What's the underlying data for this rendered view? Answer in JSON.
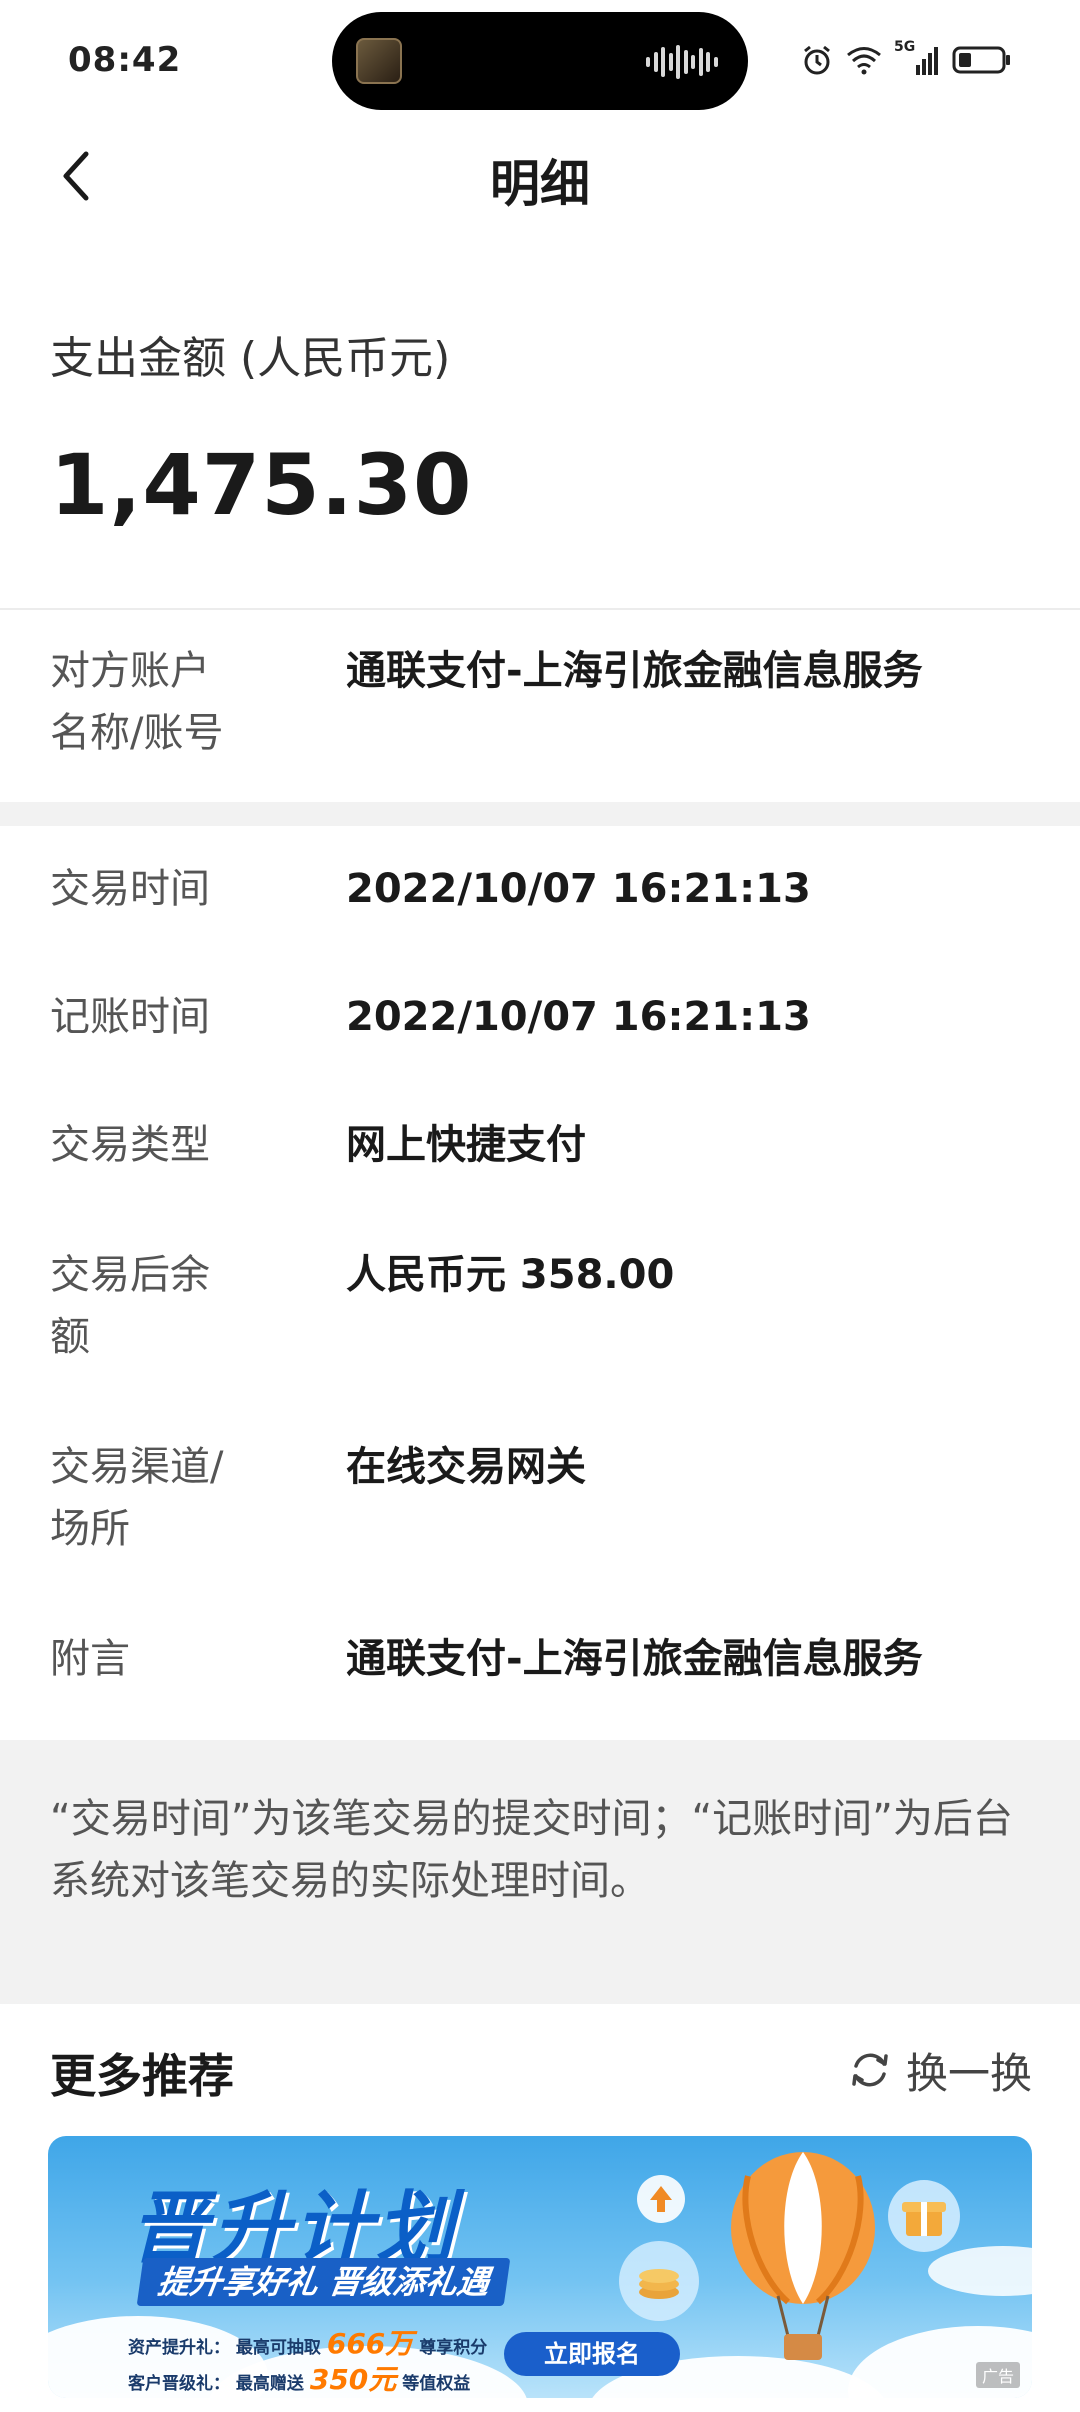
{
  "status": {
    "time": "08:42",
    "network": "5G"
  },
  "nav": {
    "title": "明细"
  },
  "amount": {
    "label": "支出金额 (人民币元)",
    "value": "1,475.30"
  },
  "counterparty": {
    "label_line1": "对方账户",
    "label_line2": "名称/账号",
    "value": "通联支付-上海引旅金融信息服务"
  },
  "details": [
    {
      "label_line1": "交易时间",
      "label_line2": "",
      "value": "2022/10/07 16:21:13"
    },
    {
      "label_line1": "记账时间",
      "label_line2": "",
      "value": "2022/10/07 16:21:13"
    },
    {
      "label_line1": "交易类型",
      "label_line2": "",
      "value": "网上快捷支付"
    },
    {
      "label_line1": "交易后余",
      "label_line2": "额",
      "value": "人民币元 358.00"
    },
    {
      "label_line1": "交易渠道/",
      "label_line2": "场所",
      "value": "在线交易网关"
    },
    {
      "label_line1": "附言",
      "label_line2": "",
      "value": "通联支付-上海引旅金融信息服务"
    }
  ],
  "note": "“交易时间”为该笔交易的提交时间；“记账时间”为后台系统对该笔交易的实际处理时间。",
  "more": {
    "title": "更多推荐",
    "refresh_label": "换一换"
  },
  "banner": {
    "title": "晋升计划",
    "subtitle": "提升享好礼 晋级添礼遇",
    "line1_label": "资产提升礼：",
    "line1_prefix": "最高可抽取",
    "line1_highlight": "666万",
    "line1_suffix": "尊享积分",
    "line2_label": "客户晋级礼：",
    "line2_prefix": "最高赠送",
    "line2_highlight": "350元",
    "line2_suffix": "等值权益",
    "cta": "立即报名",
    "ad_tag": "广告"
  },
  "colors": {
    "band_gray": "#f2f2f2",
    "banner_blue": "#1a5fcb",
    "highlight_orange": "#ff7a00"
  }
}
